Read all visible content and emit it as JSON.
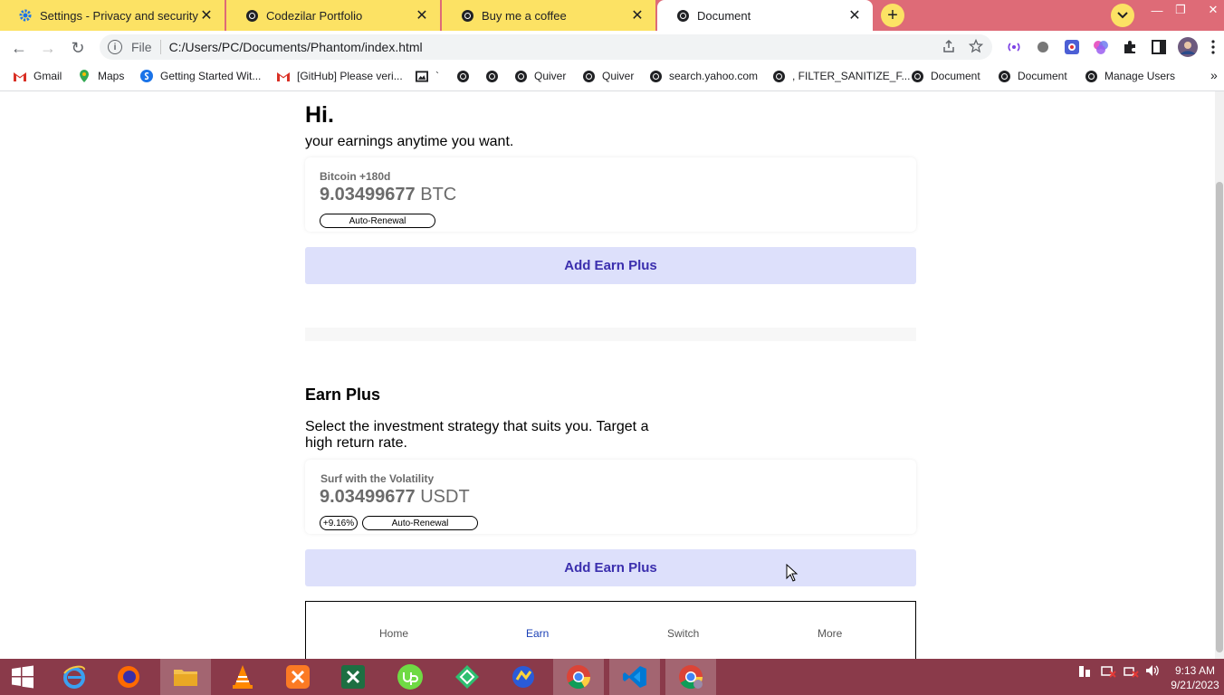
{
  "browser": {
    "tabs": [
      {
        "title": "Settings - Privacy and security",
        "icon": "settings-gear-icon"
      },
      {
        "title": "Codezilar Portfolio",
        "icon": "globe-icon"
      },
      {
        "title": "Buy me a coffee",
        "icon": "globe-icon"
      },
      {
        "title": "Document",
        "icon": "globe-icon",
        "active": true
      }
    ],
    "new_tab_label": "+",
    "address": {
      "scheme": "File",
      "url": "C:/Users/PC/Documents/Phantom/index.html"
    },
    "bookmarks": [
      {
        "label": "Gmail",
        "icon": "gmail-icon"
      },
      {
        "label": "Maps",
        "icon": "maps-icon"
      },
      {
        "label": "Getting Started Wit...",
        "icon": "shopify-icon"
      },
      {
        "label": "[GitHub] Please veri...",
        "icon": "gmail-icon"
      },
      {
        "label": "`",
        "icon": "image-icon"
      },
      {
        "label": "",
        "icon": "globe-icon"
      },
      {
        "label": "",
        "icon": "globe-icon"
      },
      {
        "label": "Quiver",
        "icon": "globe-icon"
      },
      {
        "label": "Quiver",
        "icon": "globe-icon"
      },
      {
        "label": "search.yahoo.com",
        "icon": "globe-icon"
      },
      {
        "label": ", FILTER_SANITIZE_F...",
        "icon": "globe-icon"
      },
      {
        "label": "Document",
        "icon": "globe-icon"
      },
      {
        "label": "Document",
        "icon": "globe-icon"
      },
      {
        "label": "Manage Users",
        "icon": "globe-icon"
      }
    ],
    "more_bookmarks": "»"
  },
  "page": {
    "greeting": "Hi.",
    "subtitle": "your earnings anytime you want.",
    "card1": {
      "label": "Bitcoin +180d",
      "amount": "9.03499677",
      "currency": "BTC",
      "badge": "Auto-Renewal"
    },
    "add_button": "Add Earn Plus",
    "section_title": "Earn Plus",
    "section_desc": "Select the investment strategy that suits you. Target a high return rate.",
    "card2": {
      "label": "Surf with the Volatility",
      "amount": "9.03499677",
      "currency": "USDT",
      "rate_badge": "+9.16%",
      "badge": "Auto-Renewal"
    },
    "add_button_2": "Add Earn Plus",
    "nav": {
      "home": "Home",
      "earn": "Earn",
      "switch": "Switch",
      "more": "More"
    }
  },
  "taskbar": {
    "time": "9:13 AM",
    "date": "9/21/2023"
  },
  "colors": {
    "tab_strip": "#de6b77",
    "inactive_tab": "#fce264",
    "button_bg": "#dde0fb",
    "button_text": "#3b2fae",
    "active_nav": "#1a3fb5",
    "taskbar": "#8a3a4a"
  }
}
